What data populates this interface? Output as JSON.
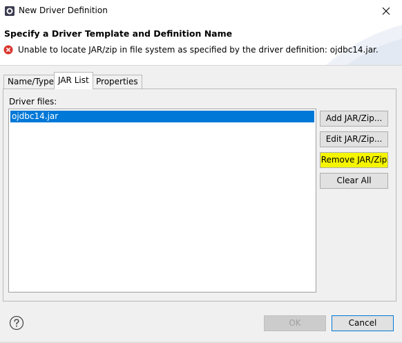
{
  "window": {
    "title": "New Driver Definition",
    "icon": "eclipse-dialog-icon",
    "close_icon": "close-icon"
  },
  "header": {
    "title": "Specify a Driver Template and Definition Name",
    "error_icon": "error-icon",
    "error_color": "#d9362f",
    "message": "Unable to locate JAR/zip in file system as specified by the driver definition: ojdbc14.jar."
  },
  "tabs": [
    {
      "label": "Name/Type",
      "active": false
    },
    {
      "label": "JAR List",
      "active": true
    },
    {
      "label": "Properties",
      "active": false
    }
  ],
  "jar_list": {
    "label": "Driver files:",
    "items": [
      "ojdbc14.jar"
    ],
    "selected_index": 0,
    "selection_color": "#0078d7",
    "buttons": {
      "add": "Add JAR/Zip...",
      "edit": "Edit JAR/Zip...",
      "remove": "Remove JAR/Zip",
      "clear": "Clear All"
    },
    "highlight_color": "#f5f500"
  },
  "footer": {
    "help_icon": "help-icon",
    "ok": "OK",
    "ok_enabled": false,
    "cancel": "Cancel"
  }
}
